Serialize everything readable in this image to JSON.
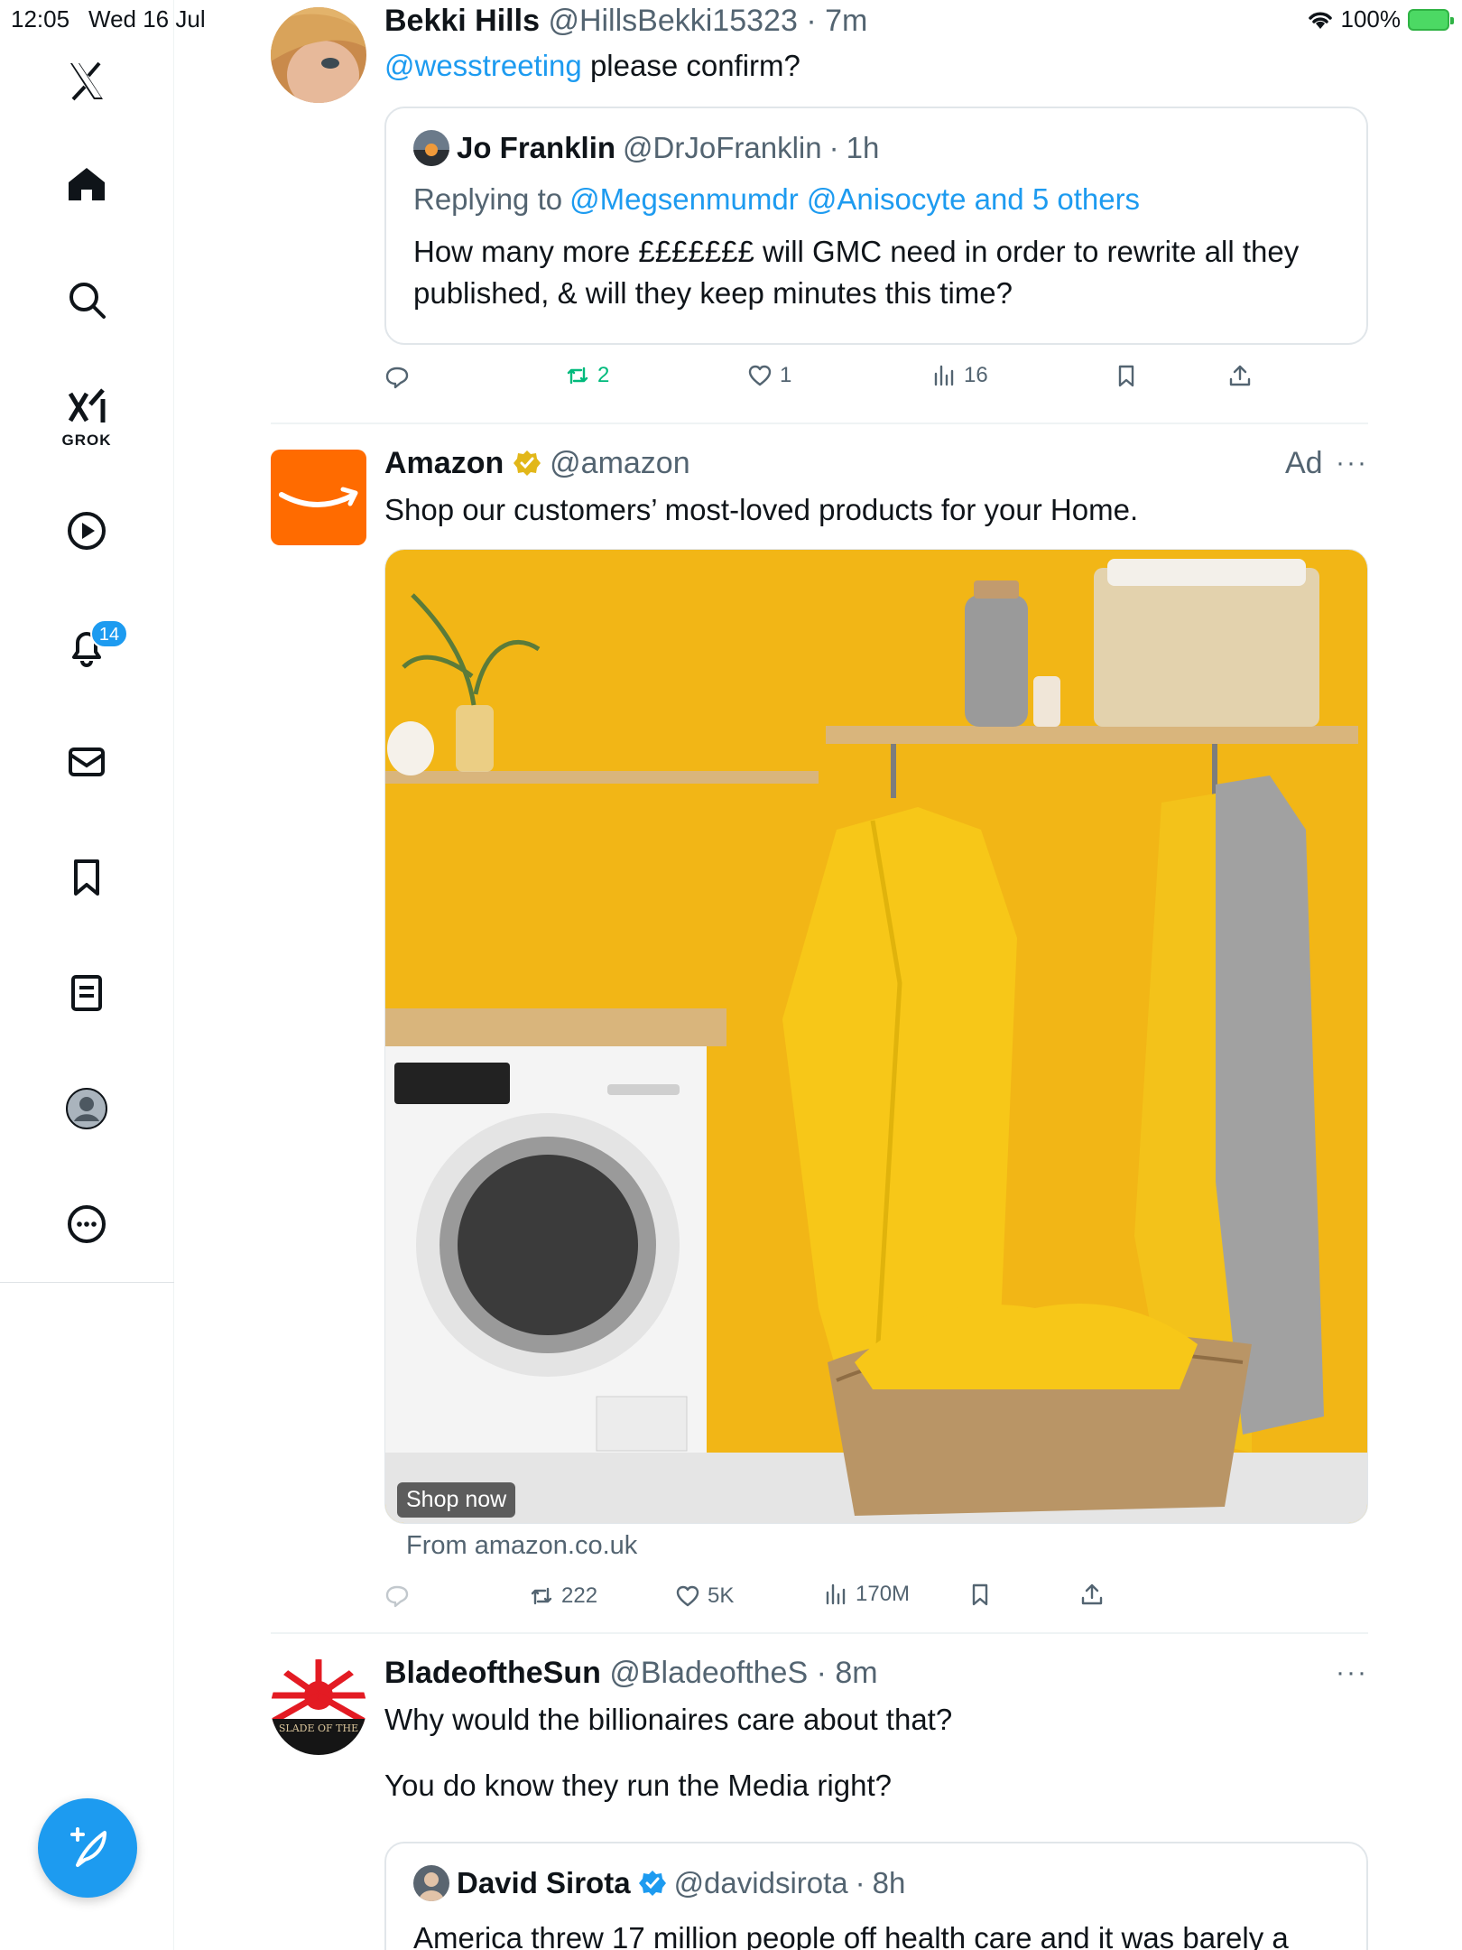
{
  "status_bar": {
    "time": "12:05",
    "date": "Wed 16 Jul",
    "battery": "100%",
    "wifi_icon": "wifi-icon",
    "battery_icon": "battery-charging-icon"
  },
  "sidebar": {
    "logo": "x-logo-icon",
    "items": [
      {
        "name": "home",
        "icon": "home-icon"
      },
      {
        "name": "explore",
        "icon": "search-icon"
      },
      {
        "name": "grok",
        "icon": "grok-icon",
        "label": "GROK"
      },
      {
        "name": "video",
        "icon": "play-icon"
      },
      {
        "name": "notifications",
        "icon": "bell-icon",
        "badge": "14"
      },
      {
        "name": "messages",
        "icon": "mail-icon"
      },
      {
        "name": "bookmarks",
        "icon": "bookmark-icon"
      },
      {
        "name": "lists",
        "icon": "list-icon"
      },
      {
        "name": "profile",
        "icon": "avatar-icon"
      },
      {
        "name": "more",
        "icon": "more-icon"
      }
    ],
    "compose_icon": "compose-feather-icon"
  },
  "feed": {
    "tweet1": {
      "name": "Bekki Hills",
      "handle": "@HillsBekki15323",
      "dot": "·",
      "time": "7m",
      "mention": "@wesstreeting",
      "text": "please confirm?",
      "quote": {
        "name": "Jo Franklin",
        "handle": "@DrJoFranklin",
        "dot": "·",
        "time": "1h",
        "replying_prefix": "Replying to",
        "replying_to": "@Megsenmumdr @Anisocyte and 5 others",
        "text_line1": "How many more £££££££ will GMC need in order to rewrite all they",
        "text_line2": "published, & will they keep minutes this time?"
      },
      "actions": {
        "reply": "",
        "retweet": "2",
        "like": "1",
        "views": "16"
      }
    },
    "ad": {
      "name": "Amazon",
      "handle": "@amazon",
      "ad_label": "Ad",
      "more": "···",
      "text": "Shop our customers’ most-loved products for your Home.",
      "shop_now": "Shop now",
      "from": "From amazon.co.uk",
      "actions": {
        "reply": "",
        "retweet": "222",
        "like": "5K",
        "views": "170M"
      }
    },
    "tweet3": {
      "name": "BladeoftheSun",
      "handle": "@BladeoftheS",
      "dot": "·",
      "time": "8m",
      "more": "···",
      "text_line1": "Why would the billionaires care about that?",
      "text_line2": "You do know they run the Media right?",
      "avatar_text": "SLADE OF THE",
      "quote": {
        "name": "David Sirota",
        "handle": "@davidsirota",
        "dot": "·",
        "time": "8h",
        "text": "America threw 17 million people off health care and it was barely a"
      }
    }
  },
  "colors": {
    "accent": "#1d9bf0",
    "retweet_green": "#00ba7c",
    "secondary_text": "#536471",
    "amazon_orange": "#ff6b00",
    "wall_yellow": "#f2b616"
  }
}
